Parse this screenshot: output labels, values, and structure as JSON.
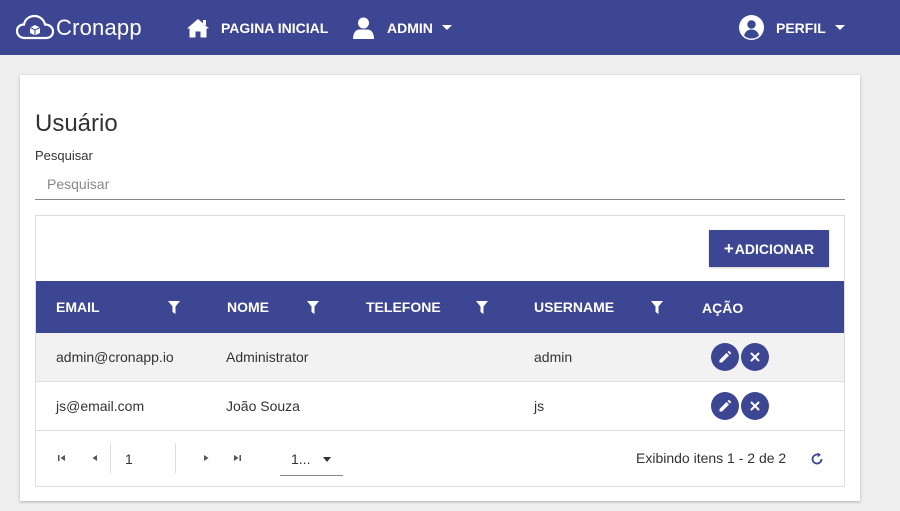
{
  "navbar": {
    "brand": "Cronapp",
    "home_label": "PAGINA INICIAL",
    "admin_label": "ADMIN",
    "perfil_label": "PERFIL",
    "bg_color": "#3d4692"
  },
  "page": {
    "title": "Usuário",
    "search_label": "Pesquisar",
    "search_placeholder": "Pesquisar",
    "search_value": ""
  },
  "grid": {
    "add_label": "ADICIONAR",
    "columns": [
      {
        "label": "EMAIL",
        "filter": true
      },
      {
        "label": "NOME",
        "filter": true
      },
      {
        "label": "TELEFONE",
        "filter": true
      },
      {
        "label": "USERNAME",
        "filter": true
      },
      {
        "label": "AÇÃO",
        "filter": false
      }
    ],
    "rows": [
      {
        "email": "admin@cronapp.io",
        "nome": "Administrator",
        "telefone": "",
        "username": "admin"
      },
      {
        "email": "js@email.com",
        "nome": "João Souza",
        "telefone": "",
        "username": "js"
      }
    ],
    "actions": [
      "edit-icon",
      "delete-icon"
    ]
  },
  "pager": {
    "current_page": "1",
    "page_size": "1...",
    "info": "Exibindo itens 1 - 2 de 2",
    "icons": [
      "first-page-icon",
      "prev-page-icon",
      "next-page-icon",
      "last-page-icon",
      "refresh-icon"
    ]
  }
}
